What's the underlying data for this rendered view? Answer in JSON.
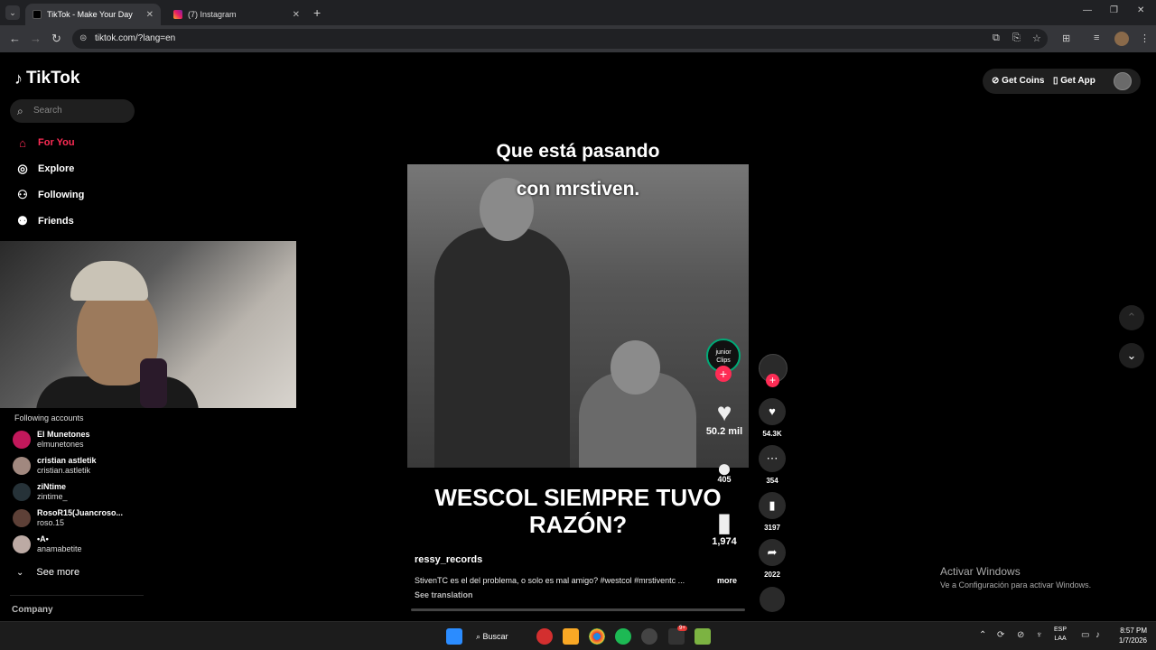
{
  "browser": {
    "tabs": [
      {
        "title": "TikTok - Make Your Day",
        "active": true
      },
      {
        "title": "(7) Instagram",
        "active": false
      }
    ],
    "url": "tiktok.com/?lang=en"
  },
  "sidebar": {
    "logo": "TikTok",
    "search_placeholder": "Search",
    "nav": [
      {
        "label": "For You",
        "icon": "home-icon",
        "active": true
      },
      {
        "label": "Explore",
        "icon": "compass-icon"
      },
      {
        "label": "Following",
        "icon": "person-icon"
      },
      {
        "label": "Friends",
        "icon": "people-icon"
      }
    ],
    "following_title": "Following accounts",
    "accounts": [
      {
        "name": "El Munetones",
        "username": "elmunetones"
      },
      {
        "name": "cristian astletik",
        "username": "cristian.astletik"
      },
      {
        "name": "ziNtime",
        "username": "zintime_"
      },
      {
        "name": "RosoR15(Juancroso...",
        "username": "roso.15"
      },
      {
        "name": "•A•",
        "username": "anamabetite"
      }
    ],
    "see_more": "See more",
    "company": "Company"
  },
  "header": {
    "get_coins": "Get Coins",
    "get_app": "Get App"
  },
  "video": {
    "caption_line1": "Que está pasando",
    "caption_line2": "con mrstiven.",
    "headline": "WESCOL SIEMPRE TUVO RAZÓN?",
    "logo_text": "junior Clips",
    "likes_embedded": "50.2 mil",
    "comments_embedded": "405",
    "saves_embedded": "1,974",
    "author": "ressy_records",
    "description": "StivenTC es el del problema, o solo es mal amigo? #westcol #mrstiventc ...",
    "more": "more",
    "see_translation": "See translation"
  },
  "actions": {
    "likes": "54.3K",
    "comments": "354",
    "saves": "3197",
    "shares": "2022"
  },
  "watermark": {
    "line1": "Activar Windows",
    "line2": "Ve a Configuración para activar Windows."
  },
  "taskbar": {
    "search": "Buscar",
    "lang_top": "ESP",
    "lang_bottom": "LAA",
    "time": "8:57 PM",
    "date": "1/7/2026",
    "notif_badge": "9+"
  }
}
